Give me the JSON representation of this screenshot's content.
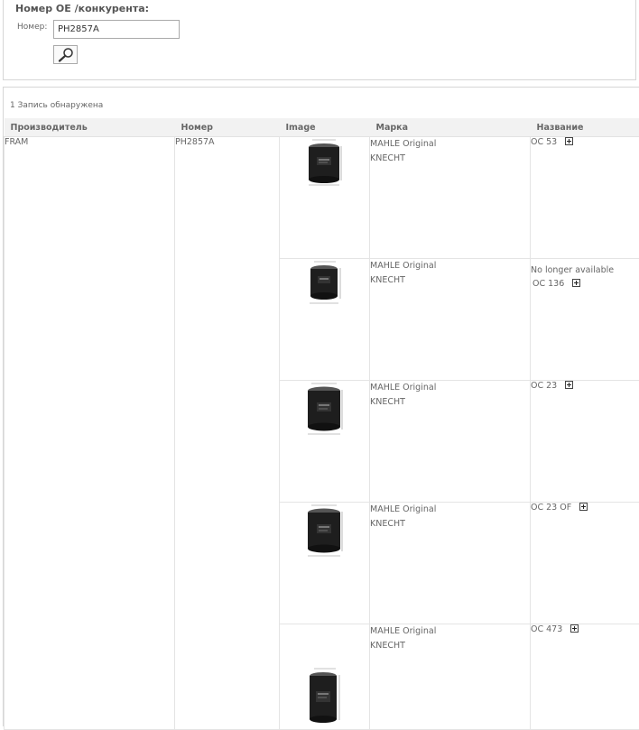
{
  "search": {
    "title": "Номер ОЕ /конкурента:",
    "field_label": "Номер:",
    "input_value": "PH2857A"
  },
  "results": {
    "count_text": "1 Запись обнаружена",
    "headers": {
      "manufacturer": "Производитель",
      "number": "Номер",
      "image": "Image",
      "brand": "Марка",
      "name": "Название"
    },
    "manufacturer": "FRAM",
    "number": "PH2857A",
    "products": [
      {
        "brand_line1": "MAHLE Original",
        "brand_line2": "KNECHT",
        "note": "",
        "code": "OC 53"
      },
      {
        "brand_line1": "MAHLE Original",
        "brand_line2": "KNECHT",
        "note": "No longer available",
        "code": "OC 136"
      },
      {
        "brand_line1": "MAHLE Original",
        "brand_line2": "KNECHT",
        "note": "",
        "code": "OC 23"
      },
      {
        "brand_line1": "MAHLE Original",
        "brand_line2": "KNECHT",
        "note": "",
        "code": "OC 23 OF"
      },
      {
        "brand_line1": "MAHLE Original",
        "brand_line2": "KNECHT",
        "note": "",
        "code": "OC 473"
      }
    ]
  },
  "icons": {
    "search_button": "magnifier-icon",
    "expand": "plus-box-icon",
    "product_image": "oil-filter-icon"
  }
}
